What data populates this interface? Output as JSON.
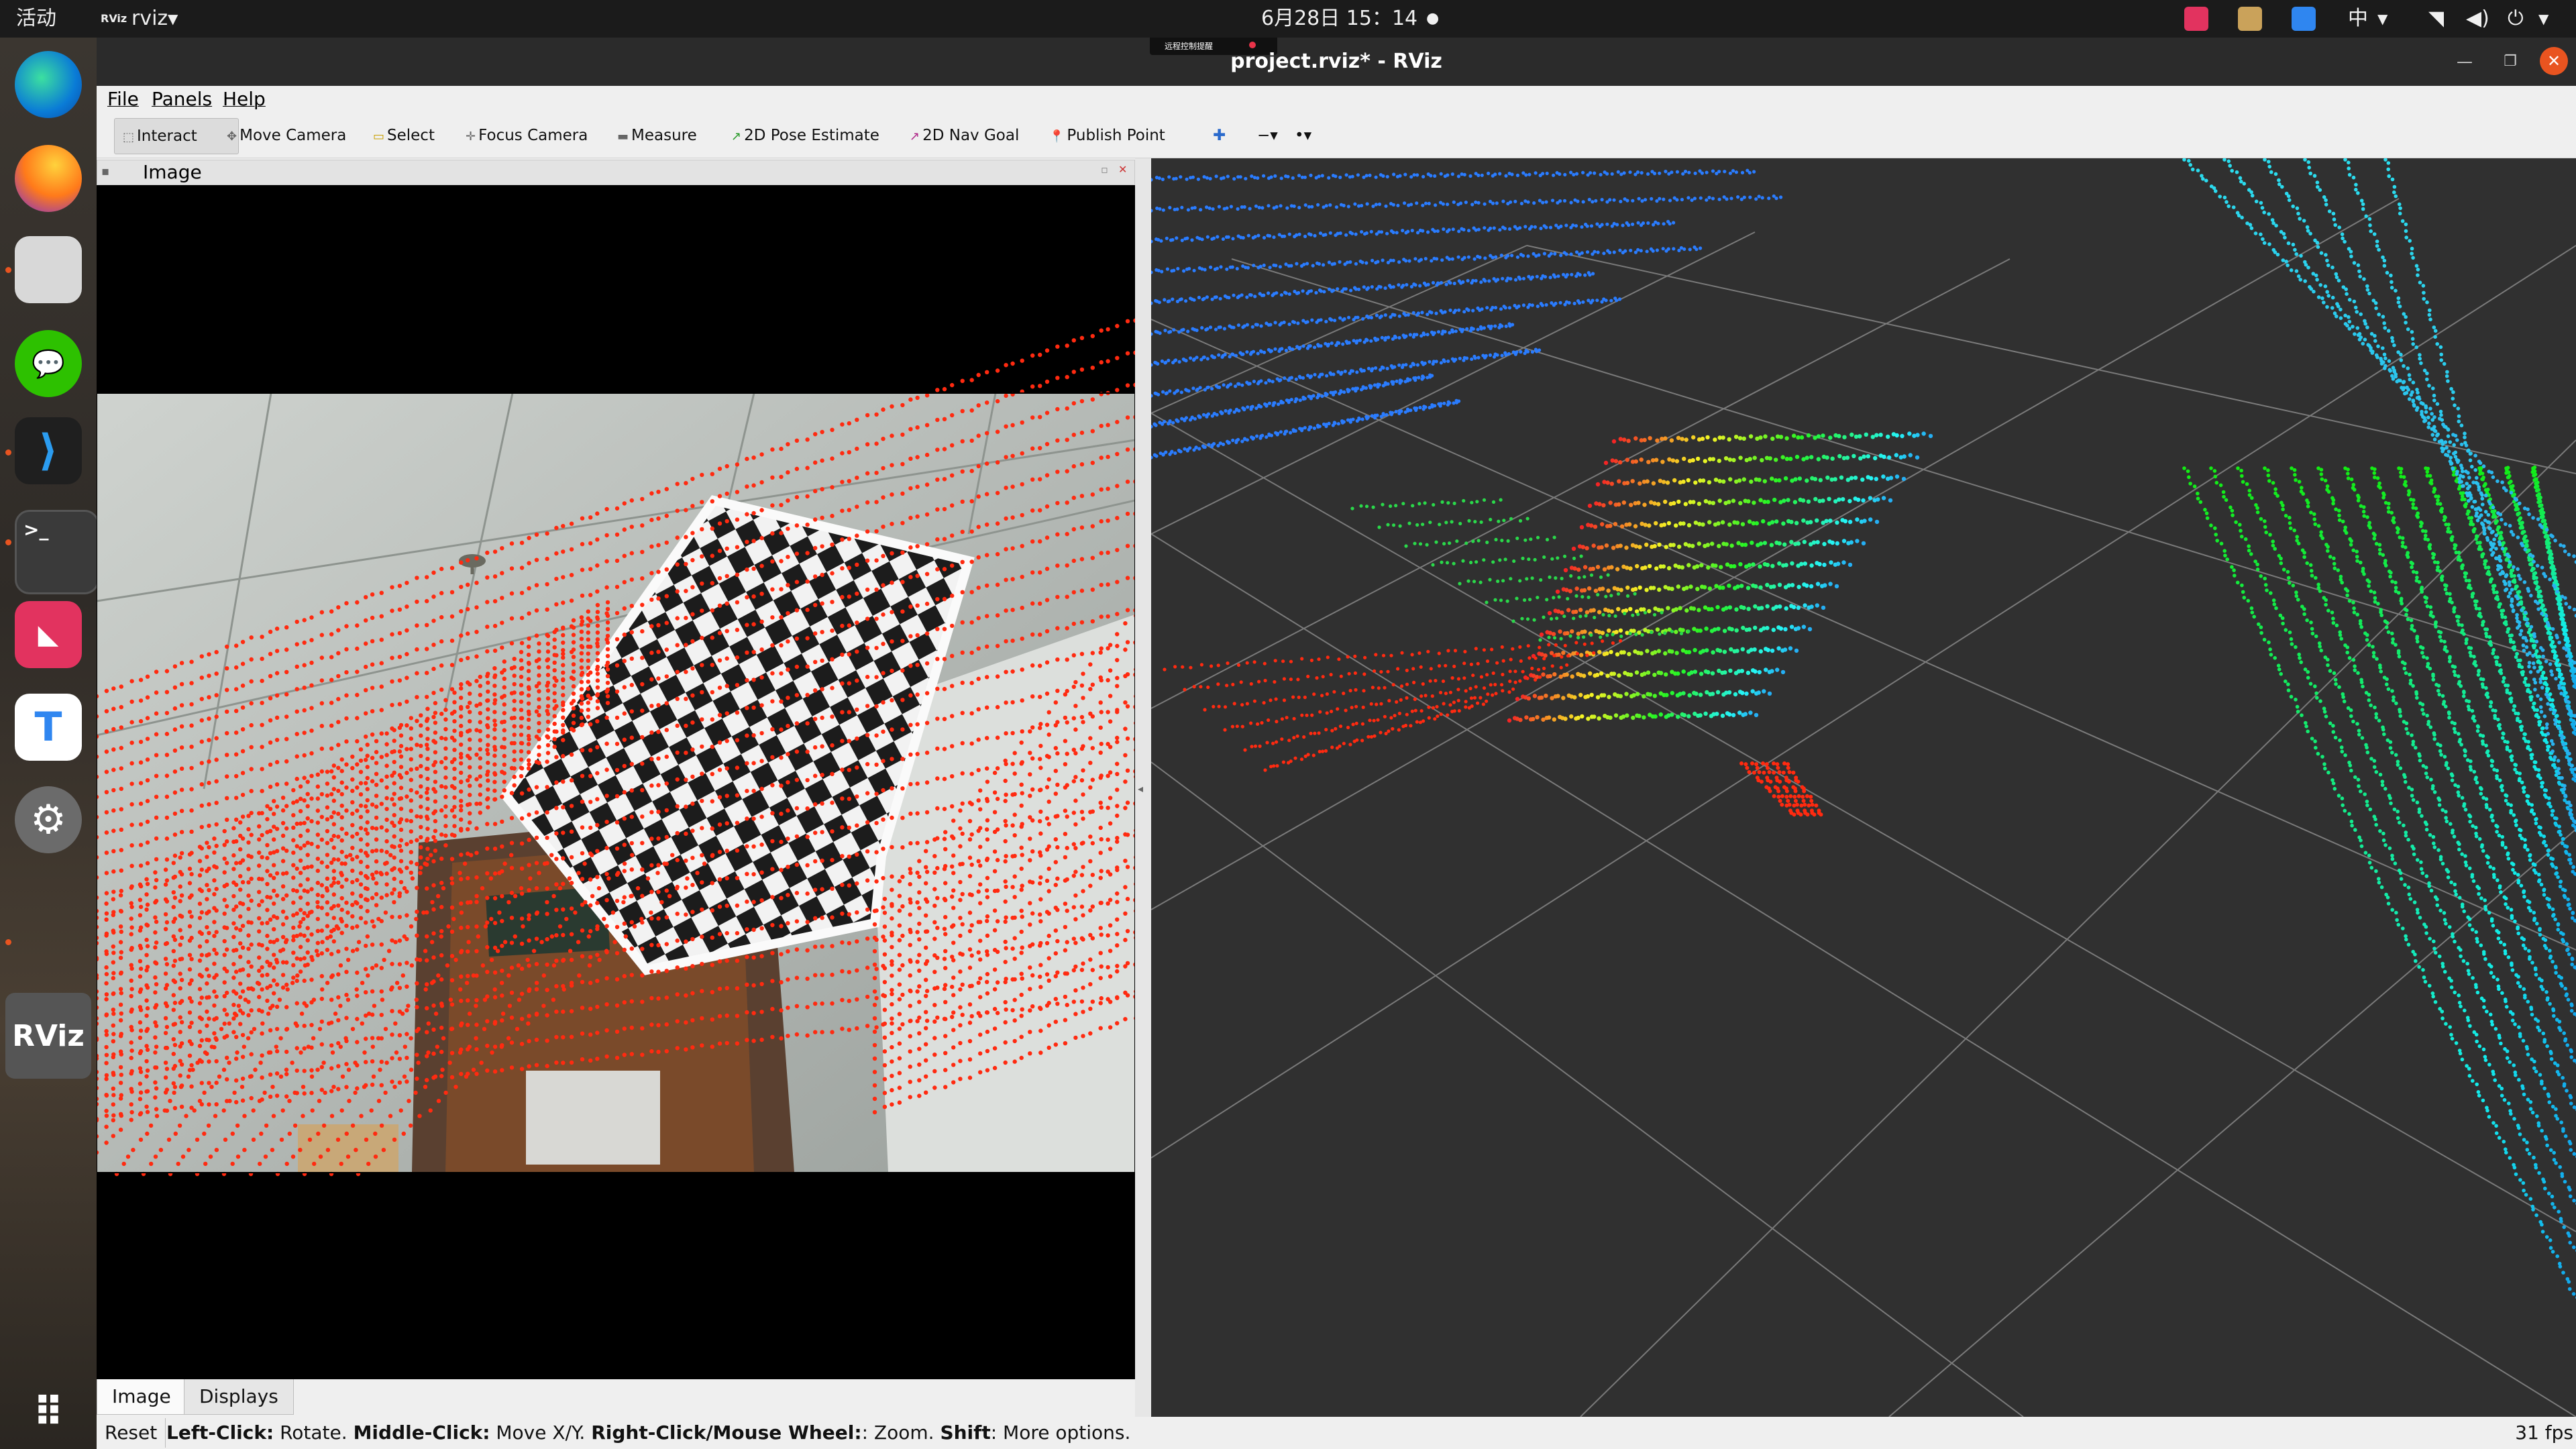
{
  "topbar": {
    "activities": "活动",
    "app_menu": "rviz",
    "clock": "6月28日  15：14",
    "input_method": "中"
  },
  "dock": {
    "apps": [
      "edge-icon",
      "firefox-icon",
      "files-icon",
      "wechat-icon",
      "vscode-icon",
      "terminal-icon",
      "app-red-icon",
      "todesk-icon",
      "settings-icon",
      "rviz-icon"
    ],
    "rviz_label": "RViz"
  },
  "window": {
    "title": "project.rviz* - RViz",
    "recording_badge": "远程控制提醒"
  },
  "menu": {
    "file": "File",
    "panels": "Panels",
    "help": "Help"
  },
  "toolbar": {
    "interact": "Interact",
    "move_camera": "Move Camera",
    "select": "Select",
    "focus_camera": "Focus Camera",
    "measure": "Measure",
    "pose_estimate": "2D Pose Estimate",
    "nav_goal": "2D Nav Goal",
    "publish_point": "Publish Point"
  },
  "image_panel": {
    "title": "Image"
  },
  "bottom_tabs": {
    "image": "Image",
    "displays": "Displays"
  },
  "status": {
    "reset": "Reset",
    "left_click": "Left-Click:",
    "rotate": " Rotate. ",
    "middle_click": "Middle-Click:",
    "move": " Move X/Y. ",
    "right_click": "Right-Click/Mouse Wheel:",
    "zoom": ": Zoom. ",
    "shift": "Shift",
    "more": ": More options.",
    "fps": "31 fps"
  },
  "colors": {
    "lidar_projection": "#ff2a10",
    "scan_near": "#1ee86a",
    "scan_far": "#2a7cff",
    "grid": "#7a7a7a",
    "view_bg": "#303030"
  }
}
